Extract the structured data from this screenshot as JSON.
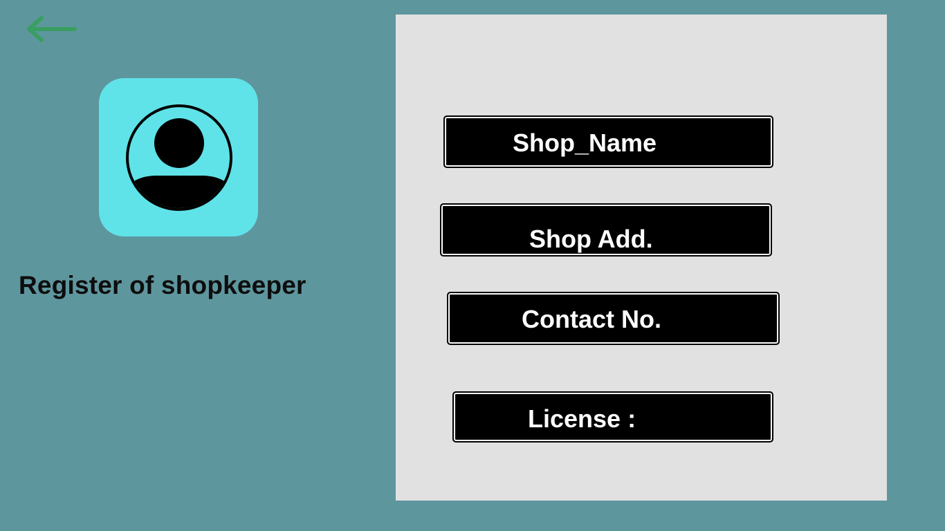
{
  "header": {
    "back_icon": "back-arrow-icon",
    "accent_color": "#3a9e63"
  },
  "profile": {
    "avatar_icon": "user-avatar-icon",
    "tile_color": "#5fe3e8",
    "title": "Register of shopkeeper"
  },
  "form": {
    "fields": [
      {
        "label": "Shop_Name"
      },
      {
        "label": "Shop Add."
      },
      {
        "label": "Contact No."
      },
      {
        "label": "License :"
      }
    ]
  }
}
